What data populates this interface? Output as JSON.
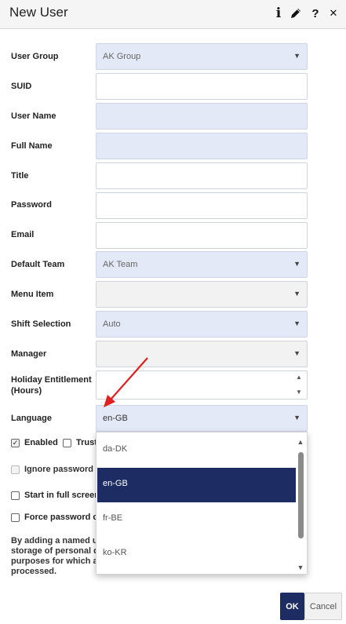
{
  "dialog": {
    "title": "New User",
    "icons": [
      "info-icon",
      "pencil-icon",
      "help-icon",
      "close-icon"
    ],
    "info_glyph": "i",
    "help_glyph": "?",
    "close_glyph": "✕",
    "accent_color": "#1d2d63",
    "field_highlight_color": "#e4e9f7"
  },
  "form": {
    "user_group": {
      "label": "User Group",
      "value": "AK Group"
    },
    "suid": {
      "label": "SUID",
      "value": ""
    },
    "user_name": {
      "label": "User Name",
      "value": ""
    },
    "full_name": {
      "label": "Full Name",
      "value": ""
    },
    "title": {
      "label": "Title",
      "value": ""
    },
    "password": {
      "label": "Password",
      "value": ""
    },
    "email": {
      "label": "Email",
      "value": ""
    },
    "default_team": {
      "label": "Default Team",
      "value": "AK Team"
    },
    "menu_item": {
      "label": "Menu Item",
      "value": ""
    },
    "shift_selection": {
      "label": "Shift Selection",
      "value": "Auto"
    },
    "manager": {
      "label": "Manager",
      "value": ""
    },
    "holiday_entitlement": {
      "label_line1": "Holiday Entitlement",
      "label_line2": "(Hours)",
      "value": ""
    },
    "language": {
      "label": "Language",
      "value": "en-GB"
    }
  },
  "checkboxes": {
    "enabled": {
      "label": "Enabled",
      "checked": true
    },
    "trusted": {
      "label": "Truste",
      "checked": false
    },
    "ignore_password": {
      "label": "Ignore password ru",
      "checked": false,
      "disabled": true
    },
    "full_screen": {
      "label": "Start in full screen",
      "checked": false
    },
    "force_password": {
      "label": "Force password cha",
      "checked": false
    }
  },
  "consent": {
    "line1": "By adding a named us",
    "line2": "storage of personal da",
    "line3": "purposes for which an",
    "line4": "processed."
  },
  "language_dropdown": {
    "options": [
      "da-DK",
      "en-GB",
      "fr-BE",
      "ko-KR"
    ],
    "selected": "en-GB"
  },
  "buttons": {
    "ok": "OK",
    "cancel": "Cancel"
  },
  "glyphs": {
    "caret": "▼",
    "spin_up": "▲",
    "spin_down": "▼",
    "check": "✓",
    "scroll_up": "▲",
    "scroll_down": "▼"
  },
  "annotation": {
    "arrow_color": "#e02020"
  }
}
